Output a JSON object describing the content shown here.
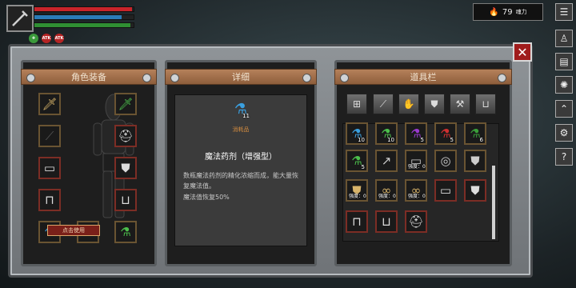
{
  "hud": {
    "health": 0.98,
    "mana": 0.88,
    "stamina": 0.97,
    "buffs": [
      "heal",
      "ATK",
      "ATK"
    ],
    "power_value": "79",
    "power_label": "魂力"
  },
  "panels": {
    "equipment": "角色装备",
    "detail": "详细",
    "inventory": "道具栏"
  },
  "detail": {
    "count": "11",
    "category": "消耗品",
    "name": "魔法药剂（增强型）",
    "description": "数瓶魔法药剂的精化浓缩而成，能大量恢复魔法值。",
    "effect": "魔法值恢复50%",
    "use_label": "点击使用"
  },
  "inventory": [
    {
      "item": "blue-potion",
      "qty": "10"
    },
    {
      "item": "green-potion",
      "qty": "10"
    },
    {
      "item": "purple-potion",
      "qty": "5"
    },
    {
      "item": "red-vial",
      "qty": "5"
    },
    {
      "item": "green-flask",
      "qty": "6"
    },
    {
      "item": "green-potion",
      "qty": "5"
    },
    {
      "item": "arrow"
    },
    {
      "item": "bracer",
      "label": "强度：0"
    },
    {
      "item": "mask"
    },
    {
      "item": "armor"
    },
    {
      "item": "armor",
      "label": "强度：0"
    },
    {
      "item": "ring",
      "label": "强度：0"
    },
    {
      "item": "ring",
      "label": "强度：0"
    },
    {
      "item": "bracer"
    },
    {
      "item": "armor"
    },
    {
      "item": "pants"
    },
    {
      "item": "boots"
    },
    {
      "item": "helmet"
    }
  ]
}
